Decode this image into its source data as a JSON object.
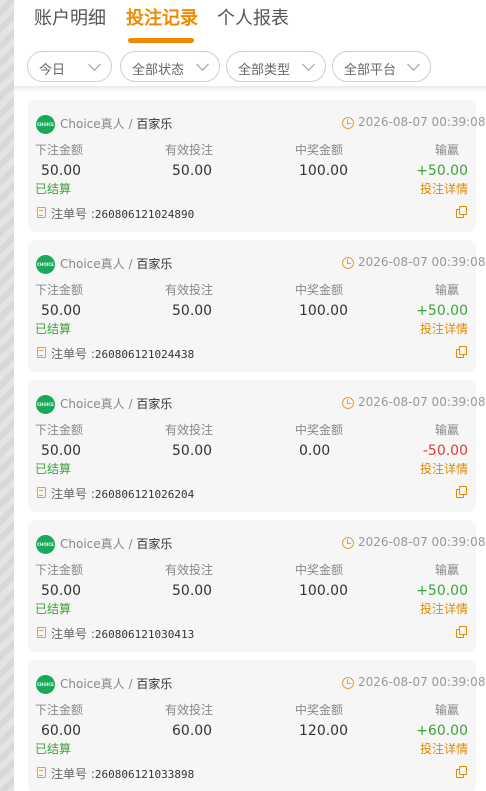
{
  "tabs": [
    {
      "label": "账户明细",
      "active": false
    },
    {
      "label": "投注记录",
      "active": true
    },
    {
      "label": "个人报表",
      "active": false
    }
  ],
  "filters": [
    {
      "label": "今日"
    },
    {
      "label": "全部状态"
    },
    {
      "label": "全部类型"
    },
    {
      "label": "全部平台"
    }
  ],
  "columns": [
    "下注金额",
    "有效投注",
    "中奖金额",
    "输赢"
  ],
  "colors": {
    "accent": "#f08a00",
    "win": "#3ba43b",
    "loss": "#e03c3c",
    "logo": "#1aa85a"
  },
  "order_label": "注单号 :",
  "detail_label": "投注详情",
  "logo_text": "CHOICE",
  "records": [
    {
      "platform": "Choice真人",
      "game": "百家乐",
      "time": "2026-08-07 00:39:08",
      "bet": "50.00",
      "valid": "50.00",
      "payout": "100.00",
      "result": "+50.00",
      "result_type": "pos",
      "status": "已结算",
      "order_no": "260806121024890"
    },
    {
      "platform": "Choice真人",
      "game": "百家乐",
      "time": "2026-08-07 00:39:08",
      "bet": "50.00",
      "valid": "50.00",
      "payout": "100.00",
      "result": "+50.00",
      "result_type": "pos",
      "status": "已结算",
      "order_no": "260806121024438"
    },
    {
      "platform": "Choice真人",
      "game": "百家乐",
      "time": "2026-08-07 00:39:08",
      "bet": "50.00",
      "valid": "50.00",
      "payout": "0.00",
      "result": "-50.00",
      "result_type": "neg",
      "status": "已结算",
      "order_no": "260806121026204"
    },
    {
      "platform": "Choice真人",
      "game": "百家乐",
      "time": "2026-08-07 00:39:08",
      "bet": "50.00",
      "valid": "50.00",
      "payout": "100.00",
      "result": "+50.00",
      "result_type": "pos",
      "status": "已结算",
      "order_no": "260806121030413"
    },
    {
      "platform": "Choice真人",
      "game": "百家乐",
      "time": "2026-08-07 00:39:08",
      "bet": "60.00",
      "valid": "60.00",
      "payout": "120.00",
      "result": "+60.00",
      "result_type": "pos",
      "status": "已结算",
      "order_no": "260806121033898"
    }
  ]
}
